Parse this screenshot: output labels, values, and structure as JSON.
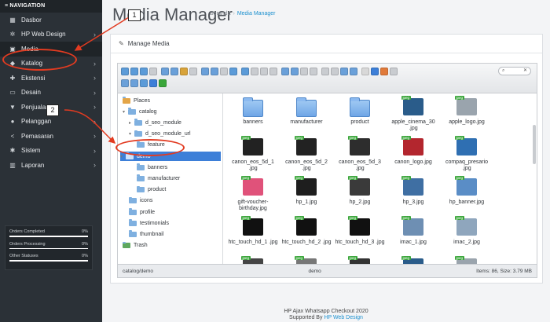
{
  "sidebar": {
    "header": "≡ NAVIGATION",
    "items": [
      {
        "label": "Dasbor",
        "icon": "dashboard-icon",
        "glyph": "▦",
        "chev": ""
      },
      {
        "label": "HP Web Design",
        "icon": "puzzle-icon",
        "glyph": "✲",
        "chev": "›"
      },
      {
        "label": "Media",
        "icon": "image-icon",
        "glyph": "▣",
        "chev": ""
      },
      {
        "label": "Katalog",
        "icon": "tag-icon",
        "glyph": "◆",
        "chev": "›"
      },
      {
        "label": "Ekstensi",
        "icon": "plugin-icon",
        "glyph": "✚",
        "chev": "›"
      },
      {
        "label": "Desain",
        "icon": "monitor-icon",
        "glyph": "▭",
        "chev": "›"
      },
      {
        "label": "Penjualan",
        "icon": "cart-icon",
        "glyph": "▼",
        "chev": "›"
      },
      {
        "label": "Pelanggan",
        "icon": "user-icon",
        "glyph": "●",
        "chev": "›"
      },
      {
        "label": "Pemasaran",
        "icon": "share-icon",
        "glyph": "<",
        "chev": "›"
      },
      {
        "label": "Sistem",
        "icon": "gear-icon",
        "glyph": "✱",
        "chev": "›"
      },
      {
        "label": "Laporan",
        "icon": "bar-chart-icon",
        "glyph": "▥",
        "chev": "›"
      }
    ],
    "stats": [
      {
        "label": "Orders Completed",
        "value": "0%"
      },
      {
        "label": "Orders Processing",
        "value": "0%"
      },
      {
        "label": "Other Statuses",
        "value": "0%"
      }
    ]
  },
  "page": {
    "title": "Media Manager",
    "crumbs": [
      "Beranda",
      "›",
      "Media Manager"
    ]
  },
  "panel": {
    "heading": "Manage Media",
    "pencil": "✎"
  },
  "search": {
    "placeholder": "",
    "clear": "✕",
    "icon": "⌕"
  },
  "tree": [
    {
      "label": "Places",
      "kind": "places"
    },
    {
      "label": "catalog",
      "kind": "drive"
    },
    {
      "label": "d_seo_module",
      "kind": "folder"
    },
    {
      "label": "d_seo_module_url",
      "kind": "folder"
    },
    {
      "label": "feature",
      "kind": "folder"
    },
    {
      "label": "demo",
      "kind": "folder"
    },
    {
      "label": "banners",
      "kind": "folder"
    },
    {
      "label": "manufacturer",
      "kind": "folder"
    },
    {
      "label": "product",
      "kind": "folder"
    },
    {
      "label": "icons",
      "kind": "folder"
    },
    {
      "label": "profile",
      "kind": "folder"
    },
    {
      "label": "testimonials",
      "kind": "folder"
    },
    {
      "label": "thumbnail",
      "kind": "folder"
    },
    {
      "label": "Trash",
      "kind": "trash"
    }
  ],
  "files": [
    {
      "name": "banners",
      "type": "folder"
    },
    {
      "name": "manufacturer",
      "type": "folder"
    },
    {
      "name": "product",
      "type": "folder"
    },
    {
      "name": "apple_cinema_30 .jpg",
      "type": "jpeg"
    },
    {
      "name": "apple_logo.jpg",
      "type": "jpeg"
    },
    {
      "name": "canon_eos_5d_1 .jpg",
      "type": "jpeg"
    },
    {
      "name": "canon_eos_5d_2 .jpg",
      "type": "jpeg"
    },
    {
      "name": "canon_eos_5d_3 .jpg",
      "type": "jpeg"
    },
    {
      "name": "canon_logo.jpg",
      "type": "jpeg"
    },
    {
      "name": "compaq_presario .jpg",
      "type": "jpeg"
    },
    {
      "name": "gift-voucher- birthday.jpg",
      "type": "jpeg"
    },
    {
      "name": "hp_1.jpg",
      "type": "jpeg"
    },
    {
      "name": "hp_2.jpg",
      "type": "jpeg"
    },
    {
      "name": "hp_3.jpg",
      "type": "jpeg"
    },
    {
      "name": "hp_banner.jpg",
      "type": "jpeg"
    },
    {
      "name": "htc_touch_hd_1 .jpg",
      "type": "jpeg"
    },
    {
      "name": "htc_touch_hd_2 .jpg",
      "type": "jpeg"
    },
    {
      "name": "htc_touch_hd_3 .jpg",
      "type": "jpeg"
    },
    {
      "name": "imac_1.jpg",
      "type": "jpeg"
    },
    {
      "name": "imac_2.jpg",
      "type": "jpeg"
    },
    {
      "name": "",
      "type": "jpeg"
    },
    {
      "name": "",
      "type": "jpeg"
    },
    {
      "name": "",
      "type": "jpeg"
    },
    {
      "name": "",
      "type": "jpeg"
    },
    {
      "name": "",
      "type": "jpeg"
    }
  ],
  "badge": "jpeg",
  "status": {
    "path": "catalog/demo",
    "folder": "demo",
    "info": "Items: 86, Size: 3.79 MB"
  },
  "footer": {
    "line1": "HP Ajax Whatsapp Checkout 2020",
    "prefix": "Supported By ",
    "link": "HP Web Design"
  },
  "callouts": {
    "one": "1",
    "two": "2"
  }
}
